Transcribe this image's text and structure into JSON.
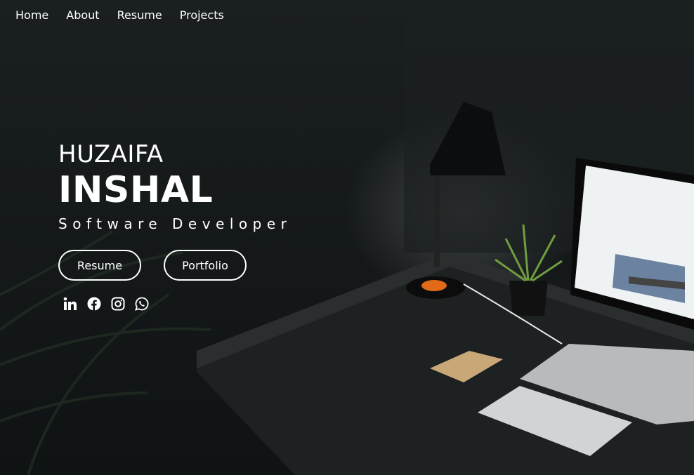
{
  "nav": {
    "items": [
      {
        "label": "Home"
      },
      {
        "label": "About"
      },
      {
        "label": "Resume"
      },
      {
        "label": "Projects"
      }
    ]
  },
  "hero": {
    "first_name": "HUZAIFA",
    "last_name": "INSHAL",
    "role": "Software Developer"
  },
  "buttons": {
    "resume_label": "Resume",
    "portfolio_label": "Portfolio"
  },
  "socials": [
    {
      "icon": "linkedin-icon"
    },
    {
      "icon": "facebook-icon"
    },
    {
      "icon": "instagram-icon"
    },
    {
      "icon": "whatsapp-icon"
    }
  ],
  "colors": {
    "text": "#ffffff",
    "background": "#15191a"
  }
}
